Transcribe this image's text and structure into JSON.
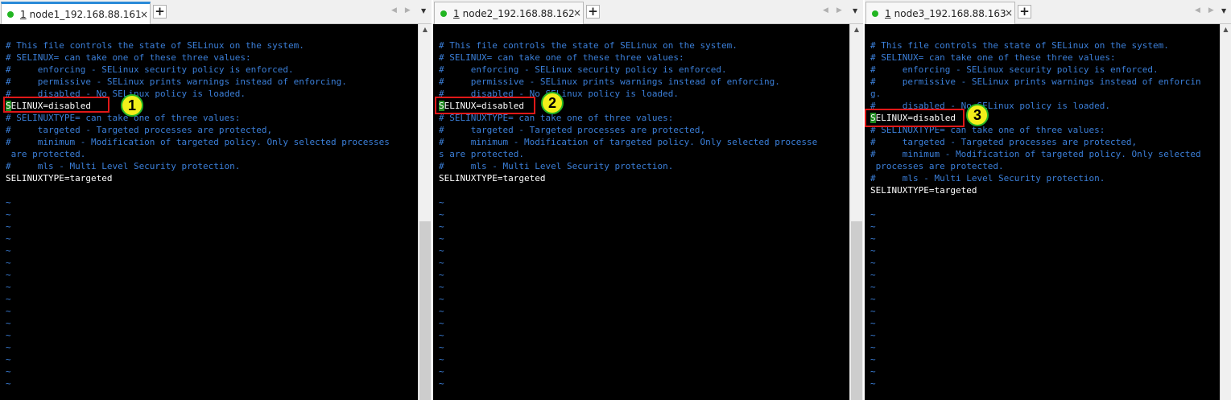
{
  "panes": [
    {
      "tab": {
        "index": "1",
        "title": "node1_192.168.88.161",
        "close": "×"
      },
      "badge": "1",
      "lines": [
        {
          "t": "# This file controls the state of SELinux on the system.",
          "k": "c"
        },
        {
          "t": "# SELINUX= can take one of these three values:",
          "k": "c"
        },
        {
          "t": "#     enforcing - SELinux security policy is enforced.",
          "k": "c"
        },
        {
          "t": "#     permissive - SELinux prints warnings instead of enforcing.",
          "k": "c"
        },
        {
          "t": "#     disabled - No SELinux policy is loaded.",
          "k": "c"
        },
        {
          "t": "SELINUX=disabled",
          "k": "w",
          "cursor": true
        },
        {
          "t": "# SELINUXTYPE= can take one of three values:",
          "k": "c"
        },
        {
          "t": "#     targeted - Targeted processes are protected,",
          "k": "c"
        },
        {
          "t": "#     minimum - Modification of targeted policy. Only selected processes",
          "k": "c"
        },
        {
          "t": " are protected.",
          "k": "c"
        },
        {
          "t": "#     mls - Multi Level Security protection.",
          "k": "c"
        },
        {
          "t": "SELINUXTYPE=targeted",
          "k": "w"
        },
        {
          "t": "",
          "k": "c"
        },
        {
          "t": "~",
          "k": "t"
        },
        {
          "t": "~",
          "k": "t"
        },
        {
          "t": "~",
          "k": "t"
        },
        {
          "t": "~",
          "k": "t"
        },
        {
          "t": "~",
          "k": "t"
        },
        {
          "t": "~",
          "k": "t"
        },
        {
          "t": "~",
          "k": "t"
        },
        {
          "t": "~",
          "k": "t"
        },
        {
          "t": "~",
          "k": "t"
        },
        {
          "t": "~",
          "k": "t"
        },
        {
          "t": "~",
          "k": "t"
        },
        {
          "t": "~",
          "k": "t"
        },
        {
          "t": "~",
          "k": "t"
        },
        {
          "t": "~",
          "k": "t"
        },
        {
          "t": "~",
          "k": "t"
        },
        {
          "t": "~",
          "k": "t"
        }
      ]
    },
    {
      "tab": {
        "index": "1",
        "title": "node2_192.168.88.162",
        "close": "×"
      },
      "badge": "2",
      "lines": [
        {
          "t": "# This file controls the state of SELinux on the system.",
          "k": "c"
        },
        {
          "t": "# SELINUX= can take one of these three values:",
          "k": "c"
        },
        {
          "t": "#     enforcing - SELinux security policy is enforced.",
          "k": "c"
        },
        {
          "t": "#     permissive - SELinux prints warnings instead of enforcing.",
          "k": "c"
        },
        {
          "t": "#     disabled - No SELinux policy is loaded.",
          "k": "c"
        },
        {
          "t": "SELINUX=disabled",
          "k": "w",
          "cursor": true
        },
        {
          "t": "# SELINUXTYPE= can take one of three values:",
          "k": "c"
        },
        {
          "t": "#     targeted - Targeted processes are protected,",
          "k": "c"
        },
        {
          "t": "#     minimum - Modification of targeted policy. Only selected processe",
          "k": "c"
        },
        {
          "t": "s are protected.",
          "k": "c"
        },
        {
          "t": "#     mls - Multi Level Security protection.",
          "k": "c"
        },
        {
          "t": "SELINUXTYPE=targeted",
          "k": "w"
        },
        {
          "t": "",
          "k": "c"
        },
        {
          "t": "~",
          "k": "t"
        },
        {
          "t": "~",
          "k": "t"
        },
        {
          "t": "~",
          "k": "t"
        },
        {
          "t": "~",
          "k": "t"
        },
        {
          "t": "~",
          "k": "t"
        },
        {
          "t": "~",
          "k": "t"
        },
        {
          "t": "~",
          "k": "t"
        },
        {
          "t": "~",
          "k": "t"
        },
        {
          "t": "~",
          "k": "t"
        },
        {
          "t": "~",
          "k": "t"
        },
        {
          "t": "~",
          "k": "t"
        },
        {
          "t": "~",
          "k": "t"
        },
        {
          "t": "~",
          "k": "t"
        },
        {
          "t": "~",
          "k": "t"
        },
        {
          "t": "~",
          "k": "t"
        },
        {
          "t": "~",
          "k": "t"
        }
      ]
    },
    {
      "tab": {
        "index": "1",
        "title": "node3_192.168.88.163",
        "close": "×"
      },
      "badge": "3",
      "lines": [
        {
          "t": "# This file controls the state of SELinux on the system.",
          "k": "c"
        },
        {
          "t": "# SELINUX= can take one of these three values:",
          "k": "c"
        },
        {
          "t": "#     enforcing - SELinux security policy is enforced.",
          "k": "c"
        },
        {
          "t": "#     permissive - SELinux prints warnings instead of enforcin",
          "k": "c"
        },
        {
          "t": "g.",
          "k": "c"
        },
        {
          "t": "#     disabled - No SELinux policy is loaded.",
          "k": "c"
        },
        {
          "t": "SELINUX=disabled",
          "k": "w",
          "cursor": true
        },
        {
          "t": "# SELINUXTYPE= can take one of three values:",
          "k": "c"
        },
        {
          "t": "#     targeted - Targeted processes are protected,",
          "k": "c"
        },
        {
          "t": "#     minimum - Modification of targeted policy. Only selected",
          "k": "c"
        },
        {
          "t": " processes are protected.",
          "k": "c"
        },
        {
          "t": "#     mls - Multi Level Security protection.",
          "k": "c"
        },
        {
          "t": "SELINUXTYPE=targeted",
          "k": "w"
        },
        {
          "t": "",
          "k": "c"
        },
        {
          "t": "~",
          "k": "t"
        },
        {
          "t": "~",
          "k": "t"
        },
        {
          "t": "~",
          "k": "t"
        },
        {
          "t": "~",
          "k": "t"
        },
        {
          "t": "~",
          "k": "t"
        },
        {
          "t": "~",
          "k": "t"
        },
        {
          "t": "~",
          "k": "t"
        },
        {
          "t": "~",
          "k": "t"
        },
        {
          "t": "~",
          "k": "t"
        },
        {
          "t": "~",
          "k": "t"
        },
        {
          "t": "~",
          "k": "t"
        },
        {
          "t": "~",
          "k": "t"
        },
        {
          "t": "~",
          "k": "t"
        },
        {
          "t": "~",
          "k": "t"
        },
        {
          "t": "~",
          "k": "t"
        }
      ]
    }
  ],
  "colors": {
    "comment": "#3b7fd9",
    "text": "#ffffff",
    "background": "#000000",
    "highlight": "#e01818",
    "badge": "#f2ef1a",
    "badge_border": "#26b526",
    "status_dot": "#22b522",
    "cursor": "#1e8a1e"
  },
  "icons": {
    "status": "green-dot-icon",
    "add_tab": "plus-icon",
    "nav": "chevron-left-right-icons",
    "menu": "dropdown-arrow-icon",
    "scroll_up": "scroll-up-arrow-icon"
  }
}
